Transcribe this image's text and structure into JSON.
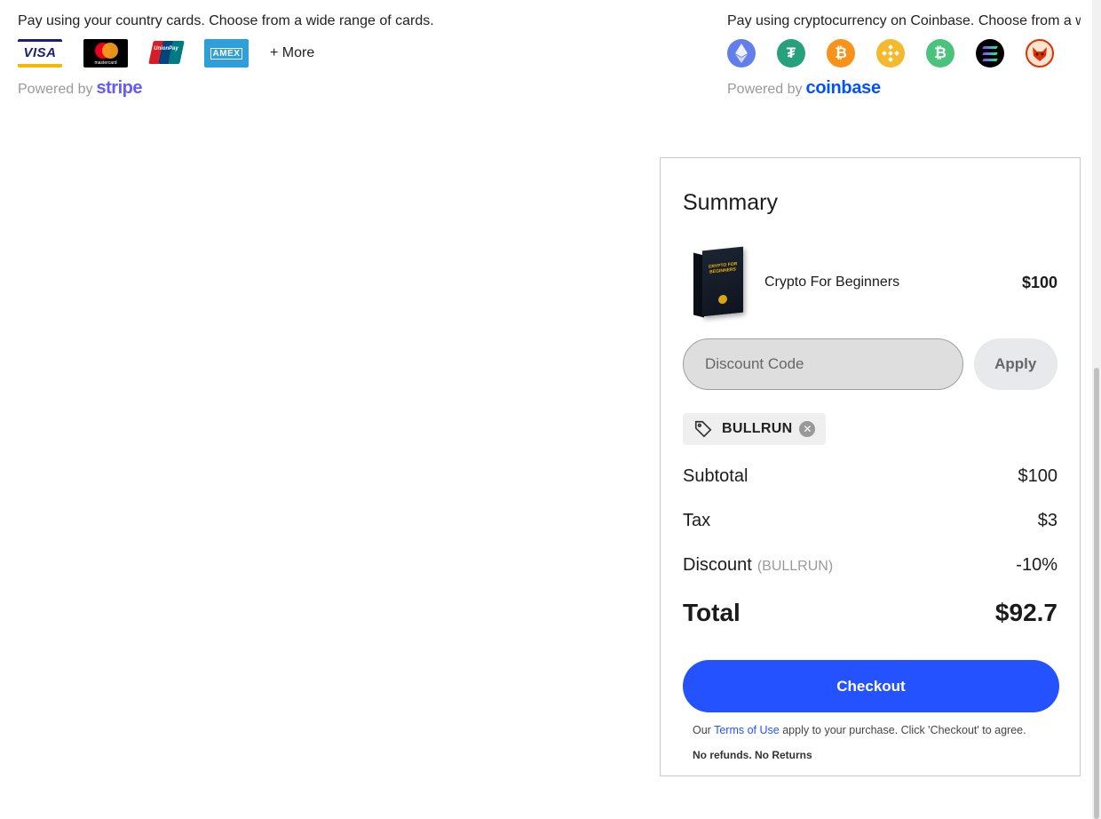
{
  "stripe": {
    "description": "Pay using your country cards. Choose from a wide range of cards.",
    "cards": [
      {
        "name": "visa",
        "label": "VISA"
      },
      {
        "name": "mastercard",
        "label": "mastercard"
      },
      {
        "name": "unionpay",
        "label": "UnionPay"
      },
      {
        "name": "amex",
        "label": "AMEX"
      }
    ],
    "more_label": "+ More",
    "powered_by": "Powered by",
    "brand": "stripe",
    "brand_color": "#635bff"
  },
  "crypto": {
    "description": "Pay using cryptocurrency on Coinbase. Choose from a wide range of currencies.",
    "coins": [
      "ethereum-icon",
      "tether-icon",
      "bitcoin-icon",
      "bnb-icon",
      "bitcoin-cash-icon",
      "solana-icon",
      "shiba-inu-icon"
    ],
    "powered_by": "Powered by",
    "brand": "coinbase",
    "brand_color": "#0052ff"
  },
  "summary": {
    "title": "Summary",
    "product": {
      "name": "Crypto For Beginners",
      "price": "$100",
      "image_label": "CRYPTO FOR BEGINNERS"
    },
    "discount": {
      "placeholder": "Discount Code",
      "apply_label": "Apply"
    },
    "coupon": {
      "code": "BULLRUN"
    },
    "rows": {
      "subtotal_label": "Subtotal",
      "subtotal_value": "$100",
      "tax_label": "Tax",
      "tax_value": "$3",
      "discount_label": "Discount",
      "discount_note": "(BULLRUN)",
      "discount_value": "-10%",
      "total_label": "Total",
      "total_value": "$92.7"
    },
    "checkout_label": "Checkout",
    "accent_color": "#2452ff",
    "terms": {
      "prefix": "Our",
      "link": "Terms of Use",
      "suffix": "apply to your purchase. Click 'Checkout' to agree."
    },
    "no_refunds": "No refunds. No Returns"
  }
}
